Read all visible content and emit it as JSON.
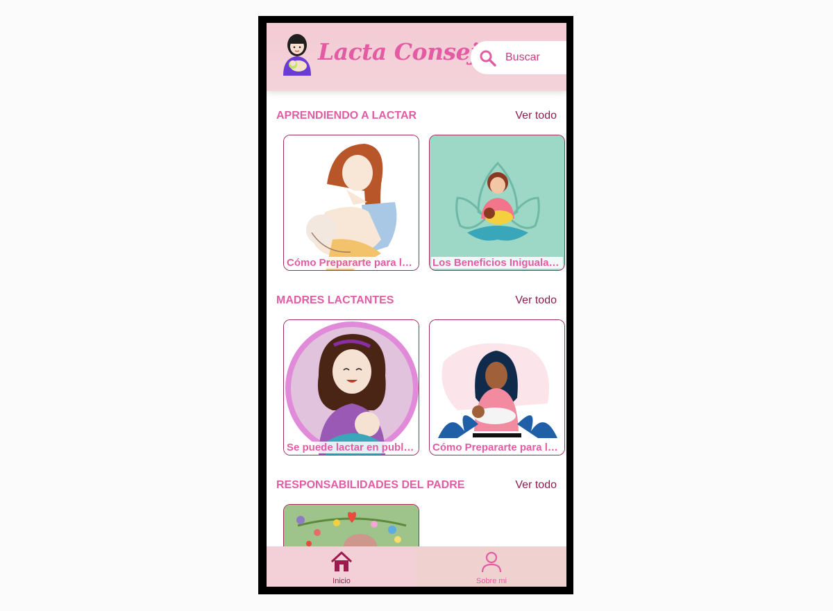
{
  "app": {
    "title": "Lacta Consejos"
  },
  "search": {
    "placeholder": "Buscar"
  },
  "sections": [
    {
      "title": "APRENDIENDO A LACTAR",
      "see_all": "Ver todo",
      "cards": [
        {
          "label": "Cómo Prepararte para la Lactancia"
        },
        {
          "label": "Los Beneficios Inigualables de la Lactancia"
        }
      ]
    },
    {
      "title": "MADRES LACTANTES",
      "see_all": "Ver todo",
      "cards": [
        {
          "label": "Se puede lactar en publico"
        },
        {
          "label": "Cómo Prepararte para la Lactancia"
        }
      ]
    },
    {
      "title": "RESPONSABILIDADES DEL PADRE",
      "see_all": "Ver todo",
      "cards": [
        {
          "label": ""
        }
      ]
    }
  ],
  "nav": {
    "home_label": "Inicio",
    "about_label": "Sobre mi"
  },
  "colors": {
    "accent": "#e35ba3",
    "dark_accent": "#9c1b4f",
    "header_bg": "#f3cbd5"
  },
  "icons": {
    "search": "search-icon",
    "home": "home-icon",
    "person": "person-icon"
  }
}
